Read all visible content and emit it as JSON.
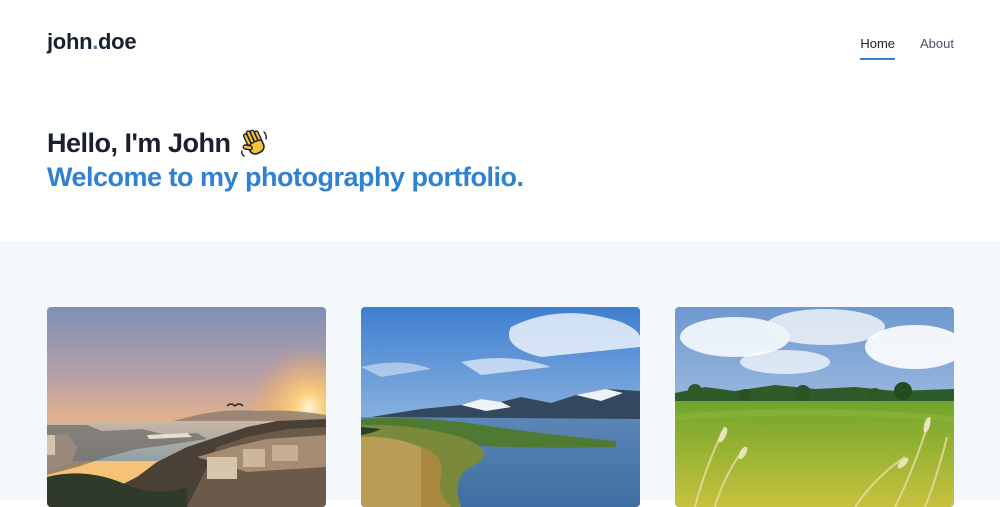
{
  "header": {
    "logo_left": "john",
    "logo_dot": ".",
    "logo_right": "doe",
    "nav": [
      {
        "label": "Home",
        "active": true
      },
      {
        "label": "About",
        "active": false
      }
    ]
  },
  "hero": {
    "greeting": "Hello, I'm John",
    "greeting_icon": "waving-hand-icon",
    "subtitle": "Welcome to my photography portfolio."
  },
  "gallery": {
    "photos": [
      {
        "subject": "sunset-harbor-city"
      },
      {
        "subject": "mountain-lake"
      },
      {
        "subject": "green-meadow"
      }
    ]
  },
  "colors": {
    "accent": "#3182ce",
    "text": "#1a202c",
    "gallery_bg": "#f5f8fb"
  }
}
